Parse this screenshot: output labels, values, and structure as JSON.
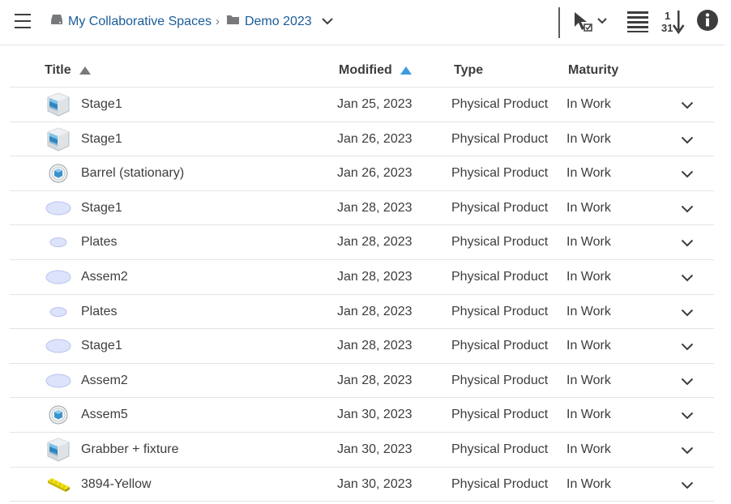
{
  "toolbar": {
    "menu_icon": "hamburger-icon",
    "breadcrumb": [
      {
        "label": "My Collaborative Spaces",
        "icon": "drive-icon"
      },
      {
        "label": "Demo 2023",
        "icon": "folder-icon"
      }
    ],
    "separator": "›",
    "actions": [
      "select-mode-icon",
      "list-view-icon",
      "sort-date-icon",
      "info-icon"
    ]
  },
  "table": {
    "columns": {
      "title": "Title",
      "modified": "Modified",
      "type": "Type",
      "maturity": "Maturity"
    },
    "sort": {
      "title_indicator": "grey",
      "modified_indicator": "blue"
    },
    "rows": [
      {
        "title": "Stage1",
        "modified": "Jan 25, 2023",
        "type": "Physical Product",
        "maturity": "In Work",
        "icon": "cube"
      },
      {
        "title": "Stage1",
        "modified": "Jan 26, 2023",
        "type": "Physical Product",
        "maturity": "In Work",
        "icon": "cube"
      },
      {
        "title": "Barrel (stationary)",
        "modified": "Jan 26, 2023",
        "type": "Physical Product",
        "maturity": "In Work",
        "icon": "part"
      },
      {
        "title": "Stage1",
        "modified": "Jan 28, 2023",
        "type": "Physical Product",
        "maturity": "In Work",
        "icon": "ellipse-large"
      },
      {
        "title": "Plates",
        "modified": "Jan 28, 2023",
        "type": "Physical Product",
        "maturity": "In Work",
        "icon": "ellipse-small"
      },
      {
        "title": "Assem2",
        "modified": "Jan 28, 2023",
        "type": "Physical Product",
        "maturity": "In Work",
        "icon": "ellipse-large"
      },
      {
        "title": "Plates",
        "modified": "Jan 28, 2023",
        "type": "Physical Product",
        "maturity": "In Work",
        "icon": "ellipse-small"
      },
      {
        "title": "Stage1",
        "modified": "Jan 28, 2023",
        "type": "Physical Product",
        "maturity": "In Work",
        "icon": "ellipse-large"
      },
      {
        "title": "Assem2",
        "modified": "Jan 28, 2023",
        "type": "Physical Product",
        "maturity": "In Work",
        "icon": "ellipse-large"
      },
      {
        "title": "Assem5",
        "modified": "Jan 30, 2023",
        "type": "Physical Product",
        "maturity": "In Work",
        "icon": "part"
      },
      {
        "title": "Grabber + fixture",
        "modified": "Jan 30, 2023",
        "type": "Physical Product",
        "maturity": "In Work",
        "icon": "cube"
      },
      {
        "title": "3894-Yellow",
        "modified": "Jan 30, 2023",
        "type": "Physical Product",
        "maturity": "In Work",
        "icon": "lego-brick"
      }
    ]
  },
  "colors": {
    "link": "#1a5c99",
    "text": "#3d3d3d",
    "sort_active": "#3d9be0",
    "divider": "#e2e4e7"
  }
}
